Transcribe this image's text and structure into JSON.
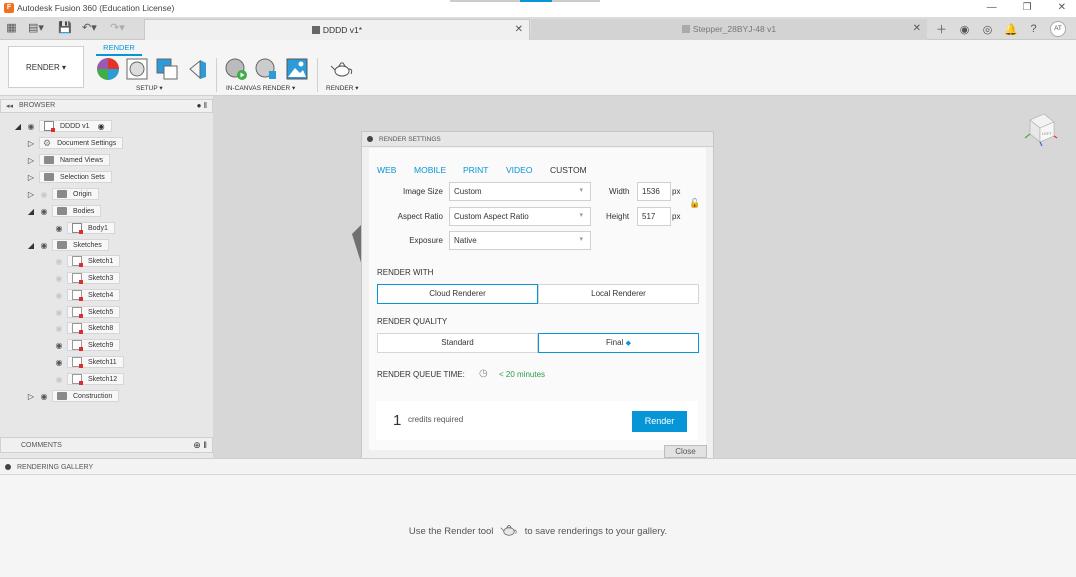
{
  "titlebar": {
    "title": "Autodesk Fusion 360 (Education License)",
    "min_icon": "minimize-icon",
    "max_icon": "maximize-icon",
    "close_icon": "close-icon"
  },
  "tabs": [
    {
      "label": "DDDD v1*",
      "active": true
    },
    {
      "label": "Stepper_28BYJ-48 v1",
      "active": false
    }
  ],
  "user": {
    "initials": "AT"
  },
  "toolbar": {
    "workspace": "RENDER ▾",
    "active_tab": "RENDER",
    "groups": {
      "setup": "SETUP ▾",
      "in_canvas": "IN-CANVAS RENDER ▾",
      "render": "RENDER ▾"
    }
  },
  "browser": {
    "header": "BROWSER",
    "root": "DDDD v1",
    "nodes": [
      {
        "label": "Document Settings"
      },
      {
        "label": "Named Views"
      },
      {
        "label": "Selection Sets"
      },
      {
        "label": "Origin"
      },
      {
        "label": "Bodies"
      },
      {
        "label": "Body1"
      },
      {
        "label": "Sketches"
      },
      {
        "label": "Sketch1"
      },
      {
        "label": "Sketch3"
      },
      {
        "label": "Sketch4"
      },
      {
        "label": "Sketch5"
      },
      {
        "label": "Sketch8"
      },
      {
        "label": "Sketch9"
      },
      {
        "label": "Sketch11"
      },
      {
        "label": "Sketch12"
      },
      {
        "label": "Construction"
      }
    ]
  },
  "comments": {
    "label": "COMMENTS"
  },
  "viewcube": {
    "face_label": "LEFT"
  },
  "render_settings": {
    "title": "RENDER SETTINGS",
    "presets": [
      "WEB",
      "MOBILE",
      "PRINT",
      "VIDEO",
      "CUSTOM"
    ],
    "active_preset": "CUSTOM",
    "image_size_label": "Image Size",
    "image_size_value": "Custom",
    "aspect_ratio_label": "Aspect Ratio",
    "aspect_ratio_value": "Custom Aspect Ratio",
    "exposure_label": "Exposure",
    "exposure_value": "Native",
    "width_label": "Width",
    "width_value": "1536",
    "height_label": "Height",
    "height_value": "517",
    "unit": "px",
    "render_with_label": "RENDER WITH",
    "render_with_options": [
      "Cloud Renderer",
      "Local Renderer"
    ],
    "render_with_selected": "Cloud Renderer",
    "quality_label": "RENDER QUALITY",
    "quality_options": [
      "Standard",
      "Final"
    ],
    "quality_selected": "Final",
    "queue_time_label": "RENDER QUEUE TIME:",
    "queue_time_value": "< 20 minutes",
    "credits_count": "1",
    "credits_label": "credits required",
    "render_button": "Render",
    "close_button": "Close"
  },
  "gallery": {
    "header": "RENDERING GALLERY",
    "message_before": "Use the Render tool",
    "message_after": "to save renderings to your gallery."
  },
  "colors": {
    "accent": "#0696d7",
    "queue_green": "#2a9d4a",
    "app_orange": "#f37021"
  }
}
